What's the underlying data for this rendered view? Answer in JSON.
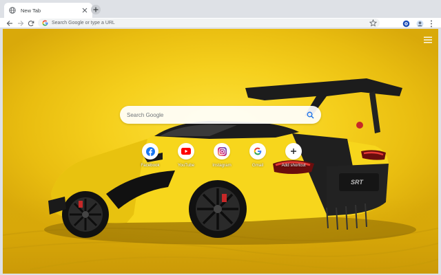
{
  "browser": {
    "tab": {
      "title": "New Tab"
    },
    "omnibox": {
      "placeholder": "Search Google or type a URL"
    }
  },
  "page": {
    "search": {
      "placeholder": "Search Google"
    },
    "shortcuts": [
      {
        "label": "Facebook",
        "icon": "facebook-icon",
        "color": "#1877f2"
      },
      {
        "label": "YouTube",
        "icon": "youtube-icon",
        "color": "#ff0000"
      },
      {
        "label": "Instagram",
        "icon": "instagram-icon",
        "color": "#c13584"
      },
      {
        "label": "Gmail",
        "icon": "google-icon",
        "color": "#4285f4"
      },
      {
        "label": "Add shortcut",
        "icon": "plus-icon",
        "color": "#202124"
      }
    ],
    "background": {
      "image": "yellow sports car wallpaper",
      "badge_text": "SRT"
    }
  },
  "colors": {
    "accent": "#1a73e8",
    "wallpaper": "#f5cf1c"
  }
}
